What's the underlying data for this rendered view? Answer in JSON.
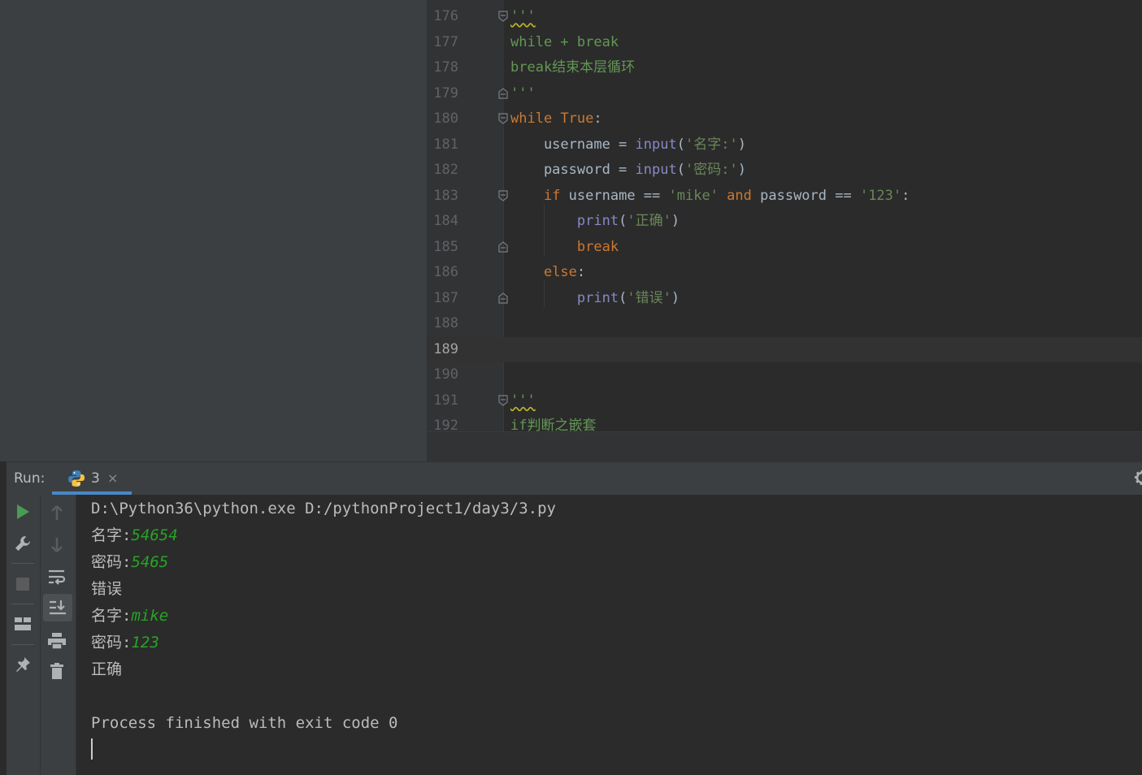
{
  "editor": {
    "current_line": "189",
    "lines": [
      {
        "no": "176",
        "tokens": [
          {
            "t": "'''",
            "c": "docstr squig"
          }
        ]
      },
      {
        "no": "177",
        "tokens": [
          {
            "t": "while + break",
            "c": "docstr"
          }
        ]
      },
      {
        "no": "178",
        "tokens": [
          {
            "t": "break结束本层循环",
            "c": "docstr"
          }
        ]
      },
      {
        "no": "179",
        "tokens": [
          {
            "t": "'''",
            "c": "docstr"
          }
        ]
      },
      {
        "no": "180",
        "tokens": [
          {
            "t": "while",
            "c": "kw"
          },
          {
            "t": " ",
            "c": ""
          },
          {
            "t": "True",
            "c": "kw"
          },
          {
            "t": ":",
            "c": ""
          }
        ]
      },
      {
        "no": "181",
        "tokens": [
          {
            "t": "    username = ",
            "c": ""
          },
          {
            "t": "input",
            "c": "bi"
          },
          {
            "t": "(",
            "c": ""
          },
          {
            "t": "'名字:'",
            "c": "str"
          },
          {
            "t": ")",
            "c": ""
          }
        ]
      },
      {
        "no": "182",
        "tokens": [
          {
            "t": "    password = ",
            "c": ""
          },
          {
            "t": "input",
            "c": "bi"
          },
          {
            "t": "(",
            "c": ""
          },
          {
            "t": "'密码:'",
            "c": "str"
          },
          {
            "t": ")",
            "c": ""
          }
        ]
      },
      {
        "no": "183",
        "tokens": [
          {
            "t": "    ",
            "c": ""
          },
          {
            "t": "if",
            "c": "kw"
          },
          {
            "t": " username == ",
            "c": ""
          },
          {
            "t": "'mike'",
            "c": "str"
          },
          {
            "t": " ",
            "c": ""
          },
          {
            "t": "and",
            "c": "kw"
          },
          {
            "t": " password == ",
            "c": ""
          },
          {
            "t": "'123'",
            "c": "str"
          },
          {
            "t": ":",
            "c": ""
          }
        ]
      },
      {
        "no": "184",
        "tokens": [
          {
            "t": "        ",
            "c": ""
          },
          {
            "t": "print",
            "c": "bi"
          },
          {
            "t": "(",
            "c": ""
          },
          {
            "t": "'正确'",
            "c": "str"
          },
          {
            "t": ")",
            "c": ""
          }
        ]
      },
      {
        "no": "185",
        "tokens": [
          {
            "t": "        ",
            "c": ""
          },
          {
            "t": "break",
            "c": "kw"
          }
        ]
      },
      {
        "no": "186",
        "tokens": [
          {
            "t": "    ",
            "c": ""
          },
          {
            "t": "else",
            "c": "kw"
          },
          {
            "t": ":",
            "c": ""
          }
        ]
      },
      {
        "no": "187",
        "tokens": [
          {
            "t": "        ",
            "c": ""
          },
          {
            "t": "print",
            "c": "bi"
          },
          {
            "t": "(",
            "c": ""
          },
          {
            "t": "'错误'",
            "c": "str"
          },
          {
            "t": ")",
            "c": ""
          }
        ]
      },
      {
        "no": "188",
        "tokens": []
      },
      {
        "no": "189",
        "tokens": []
      },
      {
        "no": "190",
        "tokens": []
      },
      {
        "no": "191",
        "tokens": [
          {
            "t": "'''",
            "c": "docstr squig"
          }
        ]
      },
      {
        "no": "192",
        "tokens": [
          {
            "t": "if判断之嵌套",
            "c": "docstr"
          }
        ]
      }
    ]
  },
  "run_panel": {
    "title": "Run:",
    "tab_label": "3",
    "tab_close": "×",
    "icons": {
      "python": "python-icon",
      "gear": "gear-icon",
      "rerun": "run-icon",
      "settings": "wrench-icon",
      "stop": "stop-icon",
      "layout": "layout-icon",
      "pin": "pin-icon",
      "up": "arrow-up-icon",
      "down": "arrow-down-icon",
      "wrap": "soft-wrap-icon",
      "scroll": "scroll-to-end-icon",
      "print": "print-icon",
      "trash": "trash-icon"
    },
    "colors": {
      "run": "#499c54",
      "input_text": "#27a327",
      "tab_underline": "#4a88c7"
    }
  },
  "console": {
    "lines": [
      {
        "text": "D:\\Python36\\python.exe D:/pythonProject1/day3/3.py",
        "input": ""
      },
      {
        "text": "名字:",
        "input": "54654"
      },
      {
        "text": "密码:",
        "input": "5465"
      },
      {
        "text": "错误",
        "input": ""
      },
      {
        "text": "名字:",
        "input": "mike"
      },
      {
        "text": "密码:",
        "input": "123"
      },
      {
        "text": "正确",
        "input": ""
      },
      {
        "text": "",
        "input": ""
      },
      {
        "text": "Process finished with exit code 0",
        "input": ""
      }
    ]
  }
}
